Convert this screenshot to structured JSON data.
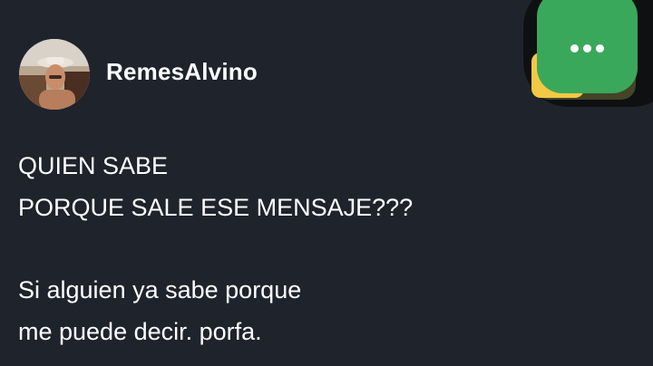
{
  "post": {
    "author": "RemesAlvino",
    "paragraph1": [
      "QUIEN SABE",
      "PORQUE SALE ESE MENSAJE???"
    ],
    "paragraph2": [
      "Si alguien ya sabe porque",
      "me puede decir. porfa."
    ]
  },
  "fab": {
    "icon": "more-dots-icon",
    "color": "#3aa85a"
  },
  "colors": {
    "background": "#1f232c",
    "text": "#ffffff"
  }
}
